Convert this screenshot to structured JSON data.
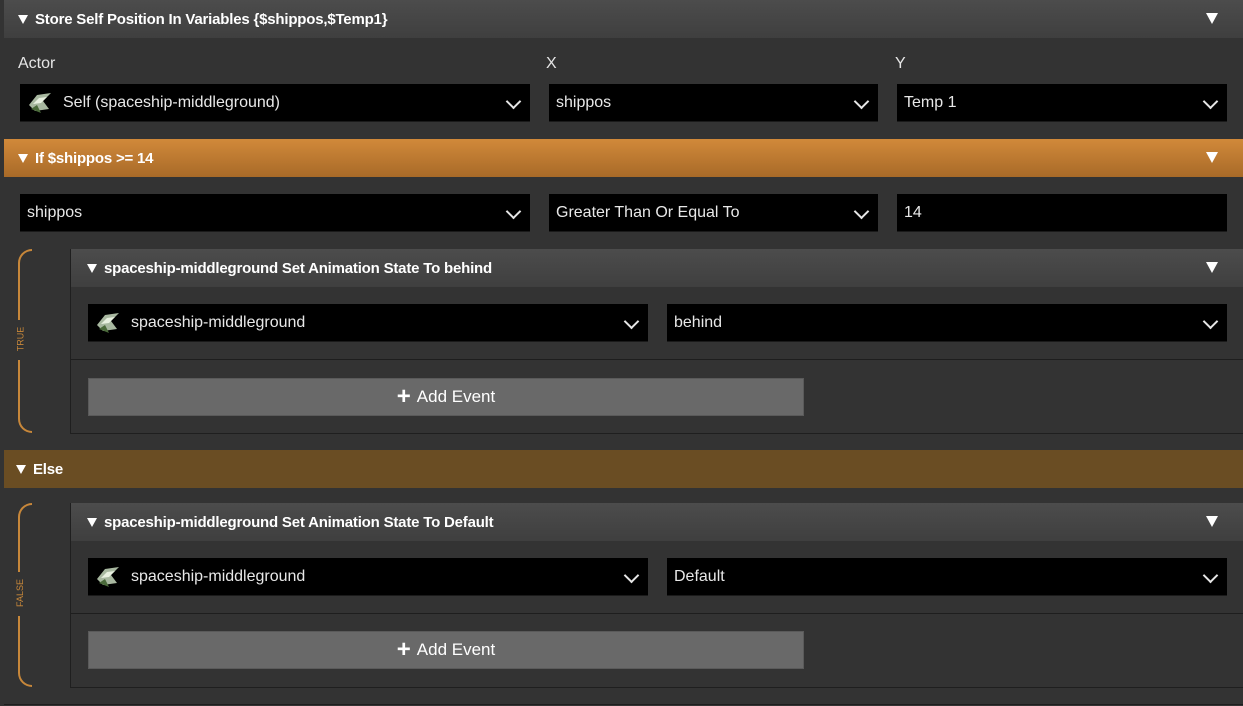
{
  "store_event": {
    "title": "Store Self Position In Variables {$shippos,$Temp1}",
    "labels": {
      "actor": "Actor",
      "x": "X",
      "y": "Y"
    },
    "actor_value": "Self (spaceship-middleground)",
    "x_value": "shippos",
    "y_value": "Temp 1"
  },
  "if_event": {
    "title": "If $shippos >= 14",
    "left_value": "shippos",
    "operator_value": "Greater Than Or Equal To",
    "right_value": "14",
    "branch_label": "TRUE",
    "child": {
      "title": "spaceship-middleground Set Animation State To behind",
      "actor_value": "spaceship-middleground",
      "state_value": "behind"
    },
    "add_event_label": "Add Event"
  },
  "else_event": {
    "title": "Else",
    "branch_label": "FALSE",
    "child": {
      "title": "spaceship-middleground Set Animation State To Default",
      "actor_value": "spaceship-middleground",
      "state_value": "Default"
    },
    "add_event_label": "Add Event"
  },
  "colors": {
    "if_header": "#c07a30",
    "else_header": "#6a4d23",
    "bracket": "#c7873a"
  }
}
